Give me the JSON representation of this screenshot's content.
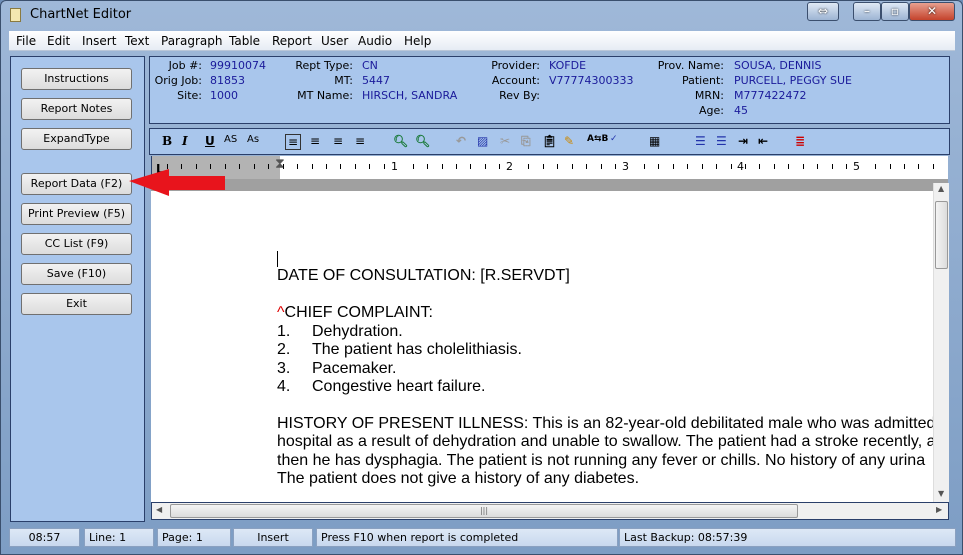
{
  "window": {
    "title": "ChartNet Editor"
  },
  "menu": [
    {
      "label": "File"
    },
    {
      "label": "Edit"
    },
    {
      "label": "Insert"
    },
    {
      "label": "Text"
    },
    {
      "label": "Paragraph"
    },
    {
      "label": "Table"
    },
    {
      "label": "Report"
    },
    {
      "label": "User"
    },
    {
      "label": "Audio"
    },
    {
      "label": "Help"
    }
  ],
  "left_buttons": [
    {
      "label": "Instructions"
    },
    {
      "label": "Report Notes"
    },
    {
      "label": "ExpandType"
    },
    {
      "label": "Report Data (F2)"
    },
    {
      "label": "Print Preview (F5)"
    },
    {
      "label": "CC List (F9)"
    },
    {
      "label": "Save (F10)"
    },
    {
      "label": "Exit"
    }
  ],
  "info": {
    "job_label": "Job #:",
    "job": "99910074",
    "orig_label": "Orig Job:",
    "orig": "81853",
    "site_label": "Site:",
    "site": "1000",
    "rept_label": "Rept Type:",
    "rept": "CN",
    "mt_label": "MT:",
    "mt": "5447",
    "mtname_label": "MT Name:",
    "mtname": "HIRSCH, SANDRA",
    "provider_label": "Provider:",
    "provider": "KOFDE",
    "account_label": "Account:",
    "account": "V77774300333",
    "revby_label": "Rev By:",
    "provname_label": "Prov. Name:",
    "provname": "SOUSA, DENNIS",
    "patient_label": "Patient:",
    "patient": "PURCELL, PEGGY SUE",
    "mrn_label": "MRN:",
    "mrn": "M777422472",
    "age_label": "Age:",
    "age": "45"
  },
  "toolbar": {
    "bold": "B",
    "italic": "I",
    "underline": "U",
    "superscript": "AS",
    "subscript": "As"
  },
  "ruler": [
    "1",
    "2",
    "3",
    "4",
    "5"
  ],
  "document": {
    "date_line": "DATE OF CONSULTATION:  [R.SERVDT]",
    "cc_marker": "^",
    "cc_heading": "CHIEF COMPLAINT:",
    "cc_items": [
      {
        "num": "1.",
        "text": "Dehydration."
      },
      {
        "num": "2.",
        "text": "The patient has cholelithiasis."
      },
      {
        "num": "3.",
        "text": "Pacemaker."
      },
      {
        "num": "4.",
        "text": "Congestive heart failure."
      }
    ],
    "hpi": [
      "HISTORY OF PRESENT ILLNESS:  This is an 82-year-old debilitated male who was admitted",
      "hospital as a result of dehydration and unable to swallow.  The patient had a stroke recently, a",
      "then he has dysphagia.  The patient is not running any fever or chills.  No history of any urina",
      "The patient does not give a history of any diabetes."
    ]
  },
  "status": {
    "time": "08:57",
    "line": "Line:  1",
    "page": "Page:  1",
    "mode": "Insert",
    "message": "Press F10 when report is completed",
    "backup": "Last Backup: 08:57:39"
  },
  "colors": {
    "panel": "#a9c6ec",
    "value_text": "#1a1a9a",
    "arrow": "#e8141c"
  }
}
